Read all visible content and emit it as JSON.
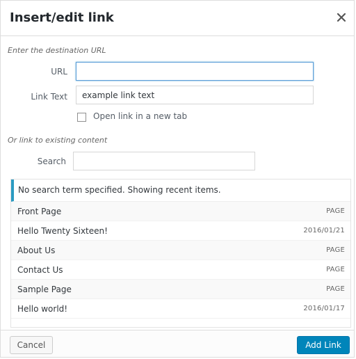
{
  "dialog": {
    "title": "Insert/edit link",
    "close_icon": "close-icon"
  },
  "url_section": {
    "hint": "Enter the destination URL",
    "url_label": "URL",
    "url_value": "",
    "link_text_label": "Link Text",
    "link_text_value": "example link text",
    "new_tab_label": "Open link in a new tab",
    "new_tab_checked": false
  },
  "search_section": {
    "hint": "Or link to existing content",
    "search_label": "Search",
    "search_value": ""
  },
  "results": {
    "notice": "No search term specified. Showing recent items.",
    "items": [
      {
        "title": "Front Page",
        "info": "PAGE"
      },
      {
        "title": "Hello Twenty Sixteen!",
        "info": "2016/01/21"
      },
      {
        "title": "About Us",
        "info": "PAGE"
      },
      {
        "title": "Contact Us",
        "info": "PAGE"
      },
      {
        "title": "Sample Page",
        "info": "PAGE"
      },
      {
        "title": "Hello world!",
        "info": "2016/01/17"
      }
    ]
  },
  "footer": {
    "cancel_label": "Cancel",
    "add_link_label": "Add Link"
  },
  "colors": {
    "accent": "#0085ba",
    "notice_border": "#2b9bc2",
    "focus_border": "#5b9dd9"
  }
}
